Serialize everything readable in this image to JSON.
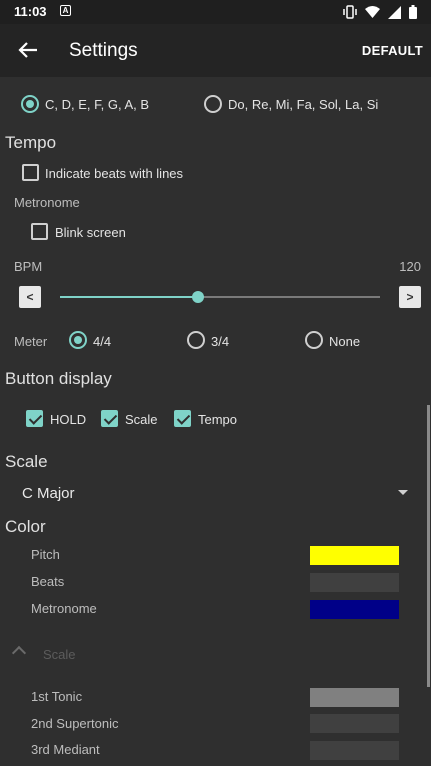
{
  "status_bar": {
    "time": "11:03",
    "notification": "A"
  },
  "app_bar": {
    "title": "Settings",
    "default_label": "DEFAULT"
  },
  "note_naming": {
    "options": [
      {
        "label": "C, D, E, F, G, A, B",
        "selected": true
      },
      {
        "label": "Do, Re, Mi, Fa, Sol, La, Si",
        "selected": false
      }
    ]
  },
  "tempo": {
    "heading": "Tempo",
    "indicate_beats_label": "Indicate beats with lines",
    "indicate_beats_checked": false,
    "metronome_label": "Metronome",
    "blink_screen_label": "Blink screen",
    "blink_screen_checked": false,
    "bpm_label": "BPM",
    "bpm_value": "120",
    "slider_fraction": 0.43,
    "decrement_label": "<",
    "increment_label": ">",
    "meter_label": "Meter",
    "meter_options": [
      {
        "label": "4/4",
        "selected": true
      },
      {
        "label": "3/4",
        "selected": false
      },
      {
        "label": "None",
        "selected": false
      }
    ]
  },
  "button_display": {
    "heading": "Button display",
    "options": [
      {
        "label": "HOLD",
        "checked": true
      },
      {
        "label": "Scale",
        "checked": true
      },
      {
        "label": "Tempo",
        "checked": true
      }
    ]
  },
  "scale": {
    "heading": "Scale",
    "selected": "C Major"
  },
  "color": {
    "heading": "Color",
    "items": [
      {
        "label": "Pitch",
        "color": "#ffff00"
      },
      {
        "label": "Beats",
        "color": "#404040"
      },
      {
        "label": "Metronome",
        "color": "#000088"
      }
    ],
    "scale_group_label": "Scale",
    "scale_items": [
      {
        "label": "1st Tonic",
        "color": "#808080"
      },
      {
        "label": "2nd Supertonic",
        "color": "#404040"
      },
      {
        "label": "3rd Mediant",
        "color": "#404040"
      }
    ]
  },
  "accent_color": "#7fd3c8"
}
